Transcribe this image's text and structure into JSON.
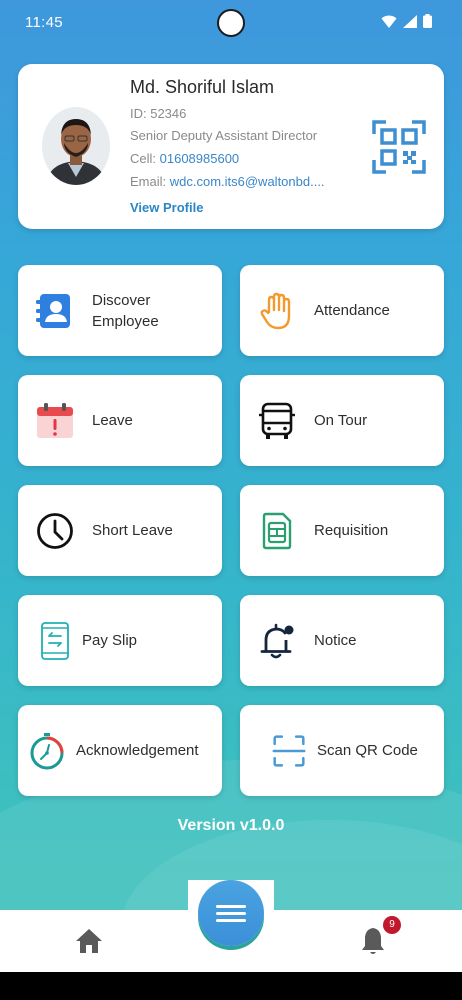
{
  "status_bar": {
    "time": "11:45"
  },
  "profile": {
    "name": "Md. Shoriful Islam",
    "id_line": "ID: 52346",
    "designation": "Senior Deputy Assistant Director",
    "cell_label": "Cell: ",
    "cell_value": "01608985600",
    "email_label": "Email: ",
    "email_value": "wdc.com.its6@waltonbd....",
    "view_profile": "View Profile"
  },
  "tiles": [
    {
      "label": "Discover Employee",
      "icon": "contact-card-icon"
    },
    {
      "label": "Attendance",
      "icon": "hand-icon"
    },
    {
      "label": "Leave",
      "icon": "calendar-alert-icon"
    },
    {
      "label": "On Tour",
      "icon": "bus-icon"
    },
    {
      "label": "Short Leave",
      "icon": "clock-icon"
    },
    {
      "label": "Requisition",
      "icon": "sim-card-icon"
    },
    {
      "label": "Pay Slip",
      "icon": "payslip-transfer-icon"
    },
    {
      "label": "Notice",
      "icon": "bell-notification-icon"
    },
    {
      "label": "Acknowledgement",
      "icon": "stopwatch-icon"
    },
    {
      "label": "Scan QR Code",
      "icon": "scan-frame-icon"
    }
  ],
  "version": "Version v1.0.0",
  "bottom_nav": {
    "notification_count": "9"
  },
  "colors": {
    "accent": "#2b86c5",
    "teal": "#2aa39a",
    "badge": "#c0192e"
  }
}
